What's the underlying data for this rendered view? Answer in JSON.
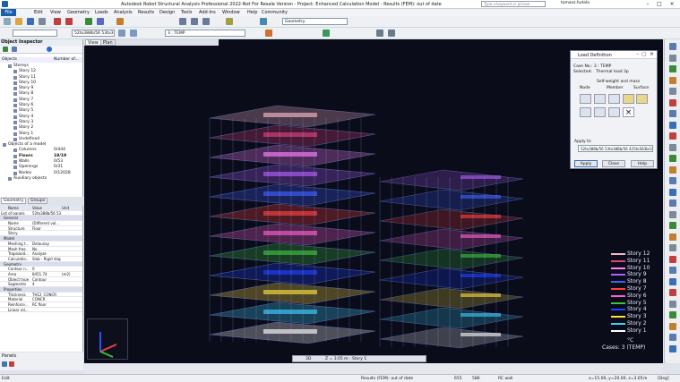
{
  "window": {
    "title": "Autodesk Robot Structural Analysis Professional 2022-Not For Resale Version - Project: Enhanced Calculation Model - Results (FEM): out of date",
    "search_placeholder": "Type a keyword or phrase",
    "user": "tomasz.fudala"
  },
  "menu": [
    "File",
    "Edit",
    "View",
    "Geometry",
    "Loads",
    "Analysis",
    "Results",
    "Design",
    "Tools",
    "Add-Ins",
    "Window",
    "Help",
    "Community"
  ],
  "toolbar": {
    "layout_combo": "Geometry",
    "panel_combo": "52to388b/56 53to3",
    "case_combo": "3 : TEMP"
  },
  "object_inspector": {
    "title": "Object Inspector",
    "col_objects": "Objects",
    "col_number": "Number of...",
    "tree": [
      {
        "label": "Storeys",
        "indent": 1,
        "value": ""
      },
      {
        "label": "Story 12",
        "indent": 2,
        "value": ""
      },
      {
        "label": "Story 11",
        "indent": 2,
        "value": ""
      },
      {
        "label": "Story 10",
        "indent": 2,
        "value": ""
      },
      {
        "label": "Story 9",
        "indent": 2,
        "value": ""
      },
      {
        "label": "Story 8",
        "indent": 2,
        "value": ""
      },
      {
        "label": "Story 7",
        "indent": 2,
        "value": ""
      },
      {
        "label": "Story 6",
        "indent": 2,
        "value": ""
      },
      {
        "label": "Story 5",
        "indent": 2,
        "value": ""
      },
      {
        "label": "Story 4",
        "indent": 2,
        "value": ""
      },
      {
        "label": "Story 3",
        "indent": 2,
        "value": ""
      },
      {
        "label": "Story 2",
        "indent": 2,
        "value": ""
      },
      {
        "label": "Story 1",
        "indent": 2,
        "value": ""
      },
      {
        "label": "Undefined",
        "indent": 2,
        "value": ""
      },
      {
        "label": "Objects of a model",
        "indent": 0,
        "value": ""
      },
      {
        "label": "Columns",
        "indent": 2,
        "value": "0/444"
      },
      {
        "label": "Floors",
        "indent": 2,
        "value": "19/19",
        "bold": true
      },
      {
        "label": "Walls",
        "indent": 2,
        "value": "0/53"
      },
      {
        "label": "Openings",
        "indent": 2,
        "value": "0/31"
      },
      {
        "label": "Nodes",
        "indent": 2,
        "value": "0/12028"
      },
      {
        "label": "Auxiliary objects",
        "indent": 1,
        "value": ""
      }
    ],
    "tabs": [
      "Geometry",
      "Groups"
    ]
  },
  "properties": {
    "cols": [
      "Name",
      "Value",
      "Unit"
    ],
    "selection": "List of panels",
    "selection_value": "52to388b/56 53to3",
    "rows": [
      {
        "n": "General",
        "v": "",
        "u": "",
        "sec": true
      },
      {
        "n": "Name",
        "v": "(Different val...",
        "u": ""
      },
      {
        "n": "Structure",
        "v": "Floor",
        "u": ""
      },
      {
        "n": "Story",
        "v": "",
        "u": ""
      },
      {
        "n": "Model",
        "v": "",
        "u": "",
        "sec": true
      },
      {
        "n": "Meshing t...",
        "v": "Delaunay",
        "u": ""
      },
      {
        "n": "Mesh free",
        "v": "No",
        "u": ""
      },
      {
        "n": "Trapezoid...",
        "v": "Analyze",
        "u": ""
      },
      {
        "n": "Calculatio...",
        "v": "Slab - Rigid diap",
        "u": ""
      },
      {
        "n": "Geometry",
        "v": "",
        "u": "",
        "sec": true
      },
      {
        "n": "Contour n...",
        "v": "0",
        "u": ""
      },
      {
        "n": "Area",
        "v": "8451.74",
        "u": "(m2)"
      },
      {
        "n": "Object type",
        "v": "Contour",
        "u": ""
      },
      {
        "n": "Segments",
        "v": "4",
        "u": ""
      },
      {
        "n": "Properties",
        "v": "",
        "u": "",
        "sec": true
      },
      {
        "n": "Thickness",
        "v": "TH12_CONCR",
        "u": ""
      },
      {
        "n": "Material",
        "v": "CONCR",
        "u": ""
      },
      {
        "n": "Reinforce...",
        "v": "RC floor",
        "u": ""
      },
      {
        "n": "Linear rel...",
        "v": "",
        "u": ""
      }
    ]
  },
  "panels_label": "Panels",
  "view_tabs": [
    "View",
    "Plan"
  ],
  "view_mode": "3D",
  "story_combo": "Z = 3.05 m - Story 1",
  "legend": {
    "items": [
      {
        "label": "Story 12",
        "color": "#f4b8c8"
      },
      {
        "label": "Story 11",
        "color": "#e04080"
      },
      {
        "label": "Story 10",
        "color": "#ff80ff"
      },
      {
        "label": "Story 9",
        "color": "#b060ff"
      },
      {
        "label": "Story 8",
        "color": "#4060ff"
      },
      {
        "label": "Story 7",
        "color": "#ff4040"
      },
      {
        "label": "Story 6",
        "color": "#ff60d0"
      },
      {
        "label": "Story 5",
        "color": "#40c040"
      },
      {
        "label": "Story 4",
        "color": "#2040ff"
      },
      {
        "label": "Story 3",
        "color": "#ffe040"
      },
      {
        "label": "Story 2",
        "color": "#40d0ff"
      },
      {
        "label": "Story 1",
        "color": "#ffffff"
      }
    ],
    "unit": "°C",
    "cases": "Cases: 3 (TEMP)"
  },
  "dialog": {
    "title": "Load Definition",
    "case_no": "Case No.: 3 : TEMP",
    "selected_label": "Selected:",
    "selected_value": "Thermal load 3p",
    "group_label": "Self-weight and mass",
    "col_node": "Node",
    "col_member": "Member",
    "col_surface": "Surface",
    "apply_to_label": "Apply to",
    "apply_to_value": "52to388b/56 53to388b/56 425to583b/3",
    "buttons": [
      "Apply",
      "Close",
      "Help"
    ]
  },
  "status": {
    "left": "Edit",
    "fem": "Results (FEM): out of date",
    "n1": "655",
    "n2": "586",
    "material": "RC wall",
    "coords": "x=15.00, y=20.00, z=3.05",
    "units": "m",
    "deg": "[Deg]"
  }
}
